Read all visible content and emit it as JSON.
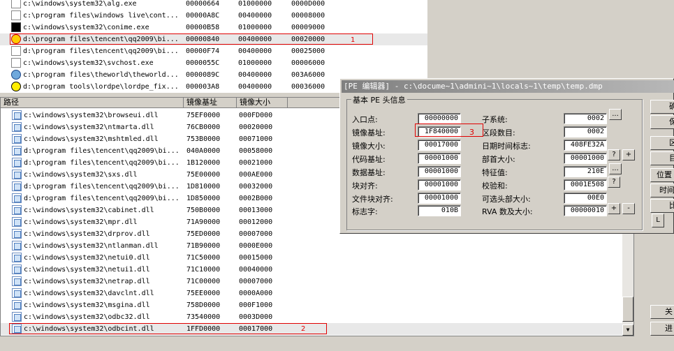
{
  "top_list": {
    "rows": [
      {
        "icon": "exe-icon",
        "path": "c:\\windows\\system32\\alg.exe",
        "pid": "00000664",
        "base": "01000000",
        "size": "0000D000"
      },
      {
        "icon": "exe-icon",
        "path": "c:\\program files\\windows live\\cont...",
        "pid": "00000A8C",
        "base": "00400000",
        "size": "00008000"
      },
      {
        "icon": "console-icon",
        "path": "c:\\windows\\system32\\conime.exe",
        "pid": "00000B58",
        "base": "01000000",
        "size": "00009000"
      },
      {
        "icon": "qq-penguin-icon",
        "path": "d:\\program files\\tencent\\qq2009\\bi...",
        "pid": "00000840",
        "base": "00400000",
        "size": "00020000"
      },
      {
        "icon": "exe-icon",
        "path": "d:\\program files\\tencent\\qq2009\\bi...",
        "pid": "00000F74",
        "base": "00400000",
        "size": "00025000"
      },
      {
        "icon": "exe-icon",
        "path": "c:\\windows\\system32\\svchost.exe",
        "pid": "0000055C",
        "base": "01000000",
        "size": "00006000"
      },
      {
        "icon": "theworld-globe-icon",
        "path": "c:\\program files\\theworld\\theworld...",
        "pid": "0000089C",
        "base": "00400000",
        "size": "003A6000"
      },
      {
        "icon": "lordpe-radiation-icon",
        "path": "d:\\program tools\\lordpe\\lordpe_fix...",
        "pid": "000003A8",
        "base": "00400000",
        "size": "00036000"
      }
    ],
    "marker": "1"
  },
  "module_list": {
    "headers": {
      "path": "路径",
      "base": "镜像基址",
      "size": "镜像大小"
    },
    "rows": [
      {
        "path": "c:\\windows\\system32\\browseui.dll",
        "base": "75EF0000",
        "size": "000FD000"
      },
      {
        "path": "c:\\windows\\system32\\ntmarta.dll",
        "base": "76CB0000",
        "size": "00020000"
      },
      {
        "path": "c:\\windows\\system32\\mshtmled.dll",
        "base": "753B0000",
        "size": "00071000"
      },
      {
        "path": "d:\\program files\\tencent\\qq2009\\bi...",
        "base": "040A0000",
        "size": "00058000"
      },
      {
        "path": "d:\\program files\\tencent\\qq2009\\bi...",
        "base": "1B120000",
        "size": "00021000"
      },
      {
        "path": "c:\\windows\\system32\\sxs.dll",
        "base": "75E00000",
        "size": "000AE000"
      },
      {
        "path": "d:\\program files\\tencent\\qq2009\\bi...",
        "base": "1D810000",
        "size": "00032000"
      },
      {
        "path": "d:\\program files\\tencent\\qq2009\\bi...",
        "base": "1D850000",
        "size": "0002B000"
      },
      {
        "path": "c:\\windows\\system32\\cabinet.dll",
        "base": "750B0000",
        "size": "00013000"
      },
      {
        "path": "c:\\windows\\system32\\mpr.dll",
        "base": "71A90000",
        "size": "00012000"
      },
      {
        "path": "c:\\windows\\system32\\drprov.dll",
        "base": "75ED0000",
        "size": "00007000"
      },
      {
        "path": "c:\\windows\\system32\\ntlanman.dll",
        "base": "71B90000",
        "size": "0000E000"
      },
      {
        "path": "c:\\windows\\system32\\netui0.dll",
        "base": "71C50000",
        "size": "00015000"
      },
      {
        "path": "c:\\windows\\system32\\netui1.dll",
        "base": "71C10000",
        "size": "00040000"
      },
      {
        "path": "c:\\windows\\system32\\netrap.dll",
        "base": "71C00000",
        "size": "00007000"
      },
      {
        "path": "c:\\windows\\system32\\davclnt.dll",
        "base": "75EE0000",
        "size": "0000A000"
      },
      {
        "path": "c:\\windows\\system32\\msgina.dll",
        "base": "758D0000",
        "size": "000F1000"
      },
      {
        "path": "c:\\windows\\system32\\odbc32.dll",
        "base": "73540000",
        "size": "0003D000"
      },
      {
        "path": "c:\\windows\\system32\\odbcint.dll",
        "base": "1FFD0000",
        "size": "00017000"
      }
    ],
    "marker": "2"
  },
  "pe_editor": {
    "title": "[PE 编辑器] - c:\\docume~1\\admini~1\\locals~1\\temp\\temp.dmp",
    "group_label": "基本 PE 头信息",
    "left_fields": [
      {
        "label": "入口点:",
        "value": "00000000"
      },
      {
        "label": "镜像基址:",
        "value": "1F840000"
      },
      {
        "label": "镜像大小:",
        "value": "00017000"
      },
      {
        "label": "代码基址:",
        "value": "00001000"
      },
      {
        "label": "数据基址:",
        "value": "00001000"
      },
      {
        "label": "块对齐:",
        "value": "00001000"
      },
      {
        "label": "文件块对齐:",
        "value": "00001000"
      },
      {
        "label": "标志字:",
        "value": "010B"
      }
    ],
    "right_fields": [
      {
        "label": "子系统:",
        "value": "0002"
      },
      {
        "label": "区段数目:",
        "value": "0002"
      },
      {
        "label": "日期时间标志:",
        "value": "408FE32A"
      },
      {
        "label": "部首大小:",
        "value": "00001000"
      },
      {
        "label": "特征值:",
        "value": "210E"
      },
      {
        "label": "校验和:",
        "value": "0001E508"
      },
      {
        "label": "可选头部大小:",
        "value": "00E0"
      },
      {
        "label": "RVA 数及大小:",
        "value": "00000010"
      }
    ],
    "spin_buttons": {
      "more": "...",
      "question": "?",
      "plus": "+",
      "minus": "-"
    },
    "marker": "3",
    "side_buttons": [
      "确",
      "保",
      "区",
      "目",
      "位置",
      "时间",
      "比"
    ],
    "small_button": "L"
  },
  "right_bottom_buttons": [
    "关",
    "进"
  ]
}
